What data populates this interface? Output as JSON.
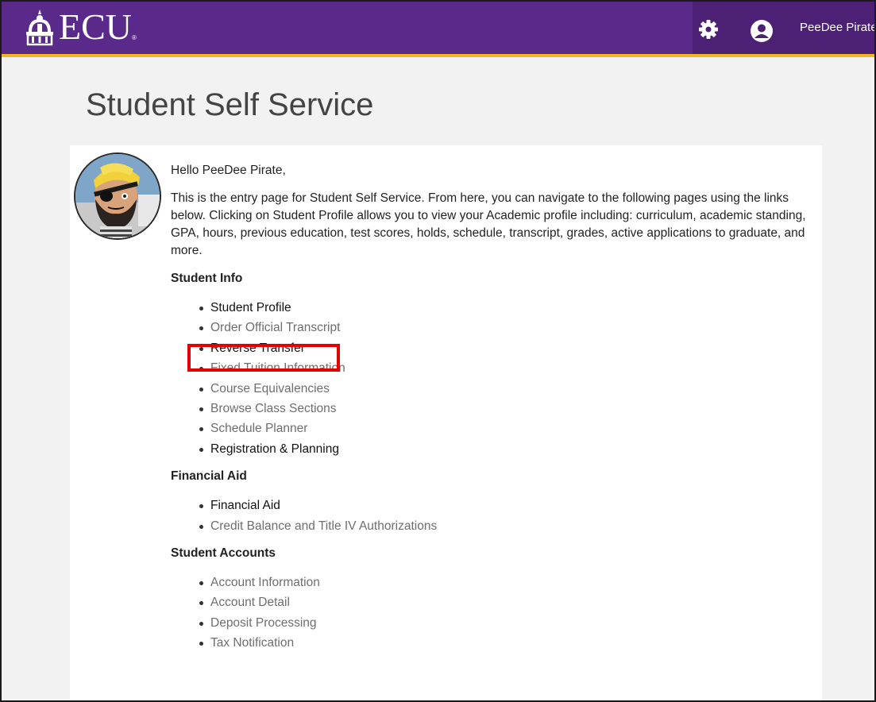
{
  "header": {
    "logo_text": "ECU",
    "logo_registered": "®",
    "settings_icon": "gear-icon",
    "user_icon": "user-icon",
    "username": "PeeDee Pirate",
    "colors": {
      "bar": "#592a8a",
      "accent": "#f4b61a"
    }
  },
  "page": {
    "title": "Student Self Service"
  },
  "intro": {
    "greeting": "Hello PeeDee Pirate,",
    "description": "This is the entry page for Student Self Service. From here, you can navigate to the following pages using the links below. Clicking on Student Profile allows you to view your Academic profile including: curriculum, academic standing, GPA, hours, previous education, test scores, holds, schedule, transcript, grades, active applications to graduate, and more."
  },
  "sections": [
    {
      "heading": "Student Info",
      "links": [
        {
          "label": "Student Profile"
        },
        {
          "label": "Order Official Transcript"
        },
        {
          "label": "Reverse Transfer",
          "highlighted": true
        },
        {
          "label": "Fixed Tuition Information"
        },
        {
          "label": "Course Equivalencies"
        },
        {
          "label": "Browse Class Sections"
        },
        {
          "label": "Schedule Planner"
        },
        {
          "label": "Registration & Planning"
        }
      ]
    },
    {
      "heading": "Financial Aid",
      "links": [
        {
          "label": "Financial Aid"
        },
        {
          "label": "Credit Balance and Title IV Authorizations"
        }
      ]
    },
    {
      "heading": "Student Accounts",
      "links": [
        {
          "label": "Account Information"
        },
        {
          "label": "Account Detail"
        },
        {
          "label": "Deposit Processing"
        },
        {
          "label": "Tax Notification"
        }
      ]
    }
  ],
  "annotation": {
    "highlight_color": "#e30000"
  }
}
